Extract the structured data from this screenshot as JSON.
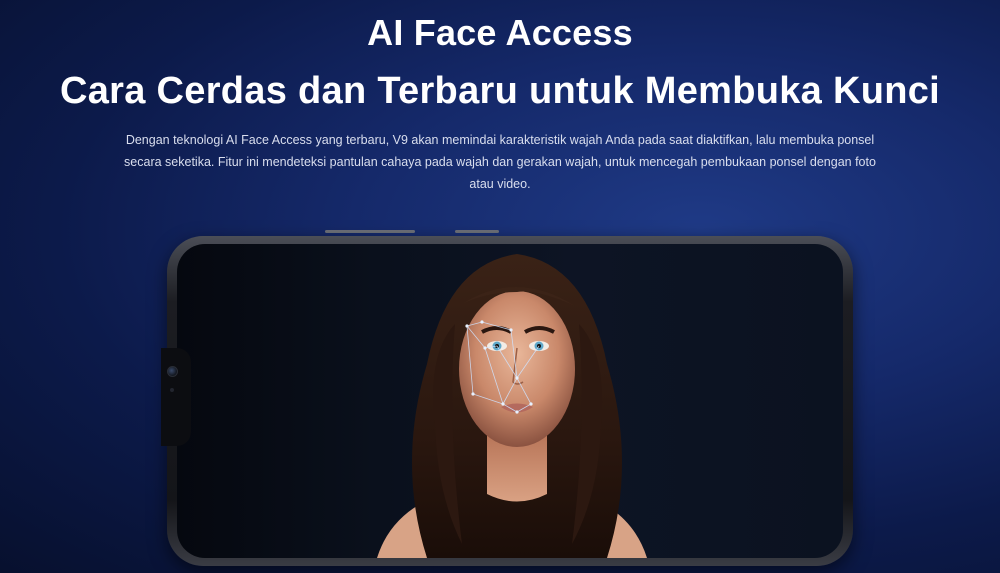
{
  "hero": {
    "title": "AI Face Access",
    "subtitle": "Cara Cerdas dan Terbaru untuk Membuka Kunci",
    "description": "Dengan teknologi AI Face Access yang terbaru, V9 akan memindai karakteristik wajah Anda pada saat diaktifkan, lalu membuka ponsel secara seketika. Fitur ini mendeteksi pantulan cahaya pada wajah dan gerakan wajah, untuk mencegah pembukaan ponsel dengan foto atau video."
  },
  "colors": {
    "background": "#15296a",
    "text": "#ffffff",
    "description_text": "#d9deee",
    "face_scan_lines": "#cfe3ff"
  },
  "device": {
    "icon": "smartphone-icon",
    "screen_content": "woman-portrait-face-scan"
  }
}
